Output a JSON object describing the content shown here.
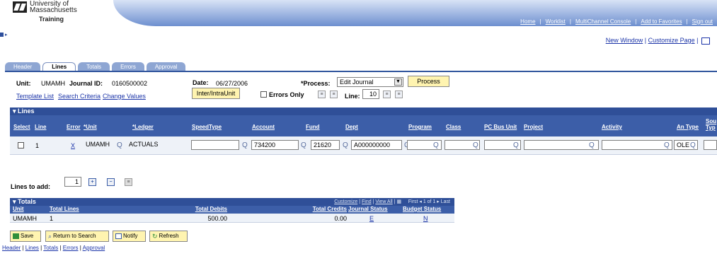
{
  "brand": {
    "line1": "University of",
    "line2": "Massachusetts",
    "line3": "Training"
  },
  "toplinks": [
    "Home",
    "Worklist",
    "MultiChannel Console",
    "Add to Favorites",
    "Sign out"
  ],
  "util": {
    "new_window": "New Window",
    "customize_page": "Customize Page"
  },
  "tabs": [
    {
      "label": "Header",
      "active": false
    },
    {
      "label": "Lines",
      "active": true
    },
    {
      "label": "Totals",
      "active": false
    },
    {
      "label": "Errors",
      "active": false
    },
    {
      "label": "Approval",
      "active": false
    }
  ],
  "header": {
    "unit_label": "Unit:",
    "unit_value": "UMAMH",
    "journal_label": "Journal ID:",
    "journal_value": "0160500002",
    "date_label": "Date:",
    "date_value": "06/27/2006",
    "process_label": "*Process:",
    "process_value": "Edit Journal",
    "process_button": "Process",
    "template_list": "Template List",
    "search_criteria": "Search Criteria",
    "change_values": "Change Values",
    "interintra_button": "Inter/IntraUnit",
    "errors_only_label": "Errors Only",
    "line_label": "Line:",
    "line_value": "10"
  },
  "lines_grid": {
    "title": "Lines",
    "columns": [
      "Select",
      "Line",
      "Error",
      "*Unit",
      "*Ledger",
      "SpeedType",
      "Account",
      "Fund",
      "Dept",
      "Program",
      "Class",
      "PC Bus Unit",
      "Project",
      "Activity",
      "An Type",
      "Sou Typ"
    ],
    "row": {
      "line": "1",
      "error": "X",
      "unit": "UMAMH",
      "ledger": "ACTUALS",
      "speedtype": "",
      "account": "734200",
      "fund": "21620",
      "dept": "A000000000",
      "program": "",
      "class": "",
      "pcbu": "",
      "project": "",
      "activity": "",
      "antype": "OLE",
      "source": ""
    }
  },
  "lines_to_add": {
    "label": "Lines to add:",
    "value": "1"
  },
  "totals_grid": {
    "title": "Totals",
    "nav": {
      "customize": "Customize",
      "find": "Find",
      "view_all": "View All",
      "first": "First",
      "range": "1 of 1",
      "last": "Last"
    },
    "columns": [
      "Unit",
      "Total Lines",
      "Total Debits",
      "Total Credits",
      "Journal Status",
      "Budget Status"
    ],
    "row": {
      "unit": "UMAMH",
      "total_lines": "1",
      "total_debits": "500.00",
      "total_credits": "0.00",
      "journal_status": "E",
      "budget_status": "N"
    }
  },
  "buttons": {
    "save": "Save",
    "return_to_search": "Return to Search",
    "notify": "Notify",
    "refresh": "Refresh"
  },
  "footer_links": [
    "Header",
    "Lines",
    "Totals",
    "Errors",
    "Approval"
  ]
}
